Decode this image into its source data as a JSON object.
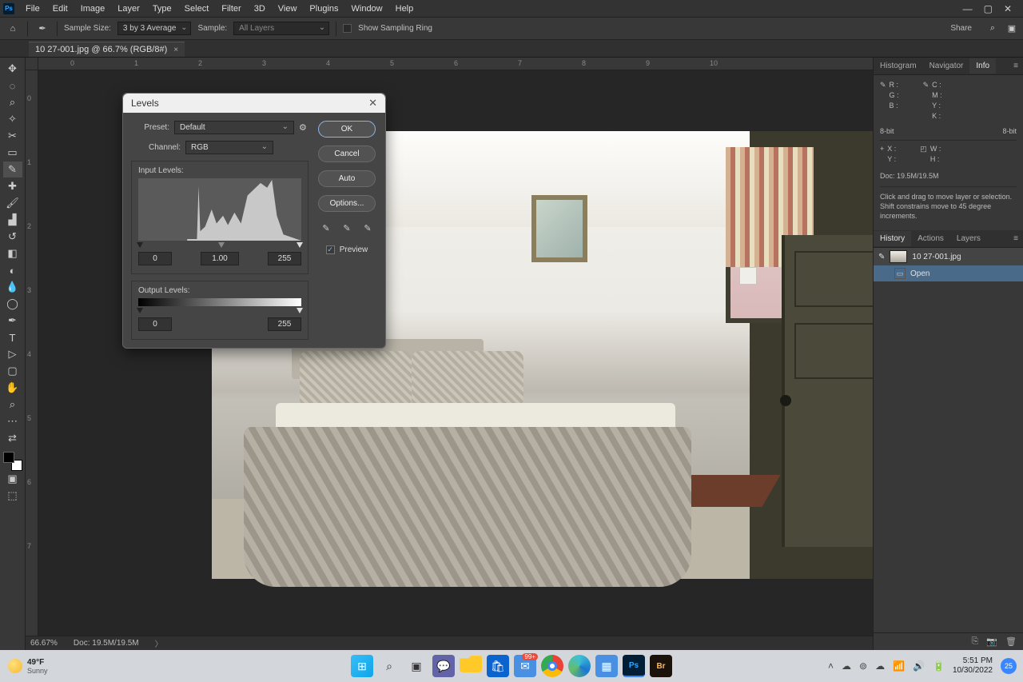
{
  "menubar": [
    "File",
    "Edit",
    "Image",
    "Layer",
    "Type",
    "Select",
    "Filter",
    "3D",
    "View",
    "Plugins",
    "Window",
    "Help"
  ],
  "optionsbar": {
    "sample_size_label": "Sample Size:",
    "sample_size_value": "3 by 3 Average",
    "sample_label": "Sample:",
    "sample_value": "All Layers",
    "show_ring": "Show Sampling Ring",
    "share": "Share"
  },
  "document": {
    "tab_title": "10 27-001.jpg @ 66.7% (RGB/8#)"
  },
  "statusbar": {
    "zoom": "66.67%",
    "doc": "Doc: 19.5M/19.5M"
  },
  "dialog": {
    "title": "Levels",
    "preset_label": "Preset:",
    "preset_value": "Default",
    "channel_label": "Channel:",
    "channel_value": "RGB",
    "input_label": "Input Levels:",
    "input_vals": [
      "0",
      "1.00",
      "255"
    ],
    "output_label": "Output Levels:",
    "output_vals": [
      "0",
      "255"
    ],
    "ok": "OK",
    "cancel": "Cancel",
    "auto": "Auto",
    "options": "Options...",
    "preview": "Preview"
  },
  "panels": {
    "group1_tabs": [
      "Histogram",
      "Navigator",
      "Info"
    ],
    "info": {
      "col1": [
        "R",
        "G",
        "B"
      ],
      "col2": [
        "C",
        "M",
        "Y",
        "K"
      ],
      "bit1": "8-bit",
      "bit2": "8-bit",
      "xy": [
        "X",
        "Y"
      ],
      "wh": [
        "W",
        "H"
      ],
      "doc": "Doc: 19.5M/19.5M",
      "hint": "Click and drag to move layer or selection. Shift constrains move to 45 degree increments."
    },
    "group2_tabs": [
      "History",
      "Actions",
      "Layers"
    ],
    "history_file": "10 27-001.jpg",
    "history_open": "Open"
  },
  "taskbar": {
    "temp": "49°F",
    "cond": "Sunny",
    "badge": "99+",
    "time": "5:51 PM",
    "date": "10/30/2022",
    "notif": "25"
  },
  "ruler_h": [
    "0",
    "1",
    "2",
    "3",
    "4",
    "5",
    "6",
    "7",
    "8",
    "9",
    "10"
  ],
  "ruler_v": [
    "0",
    "1",
    "2",
    "3",
    "4",
    "5",
    "6",
    "7"
  ]
}
